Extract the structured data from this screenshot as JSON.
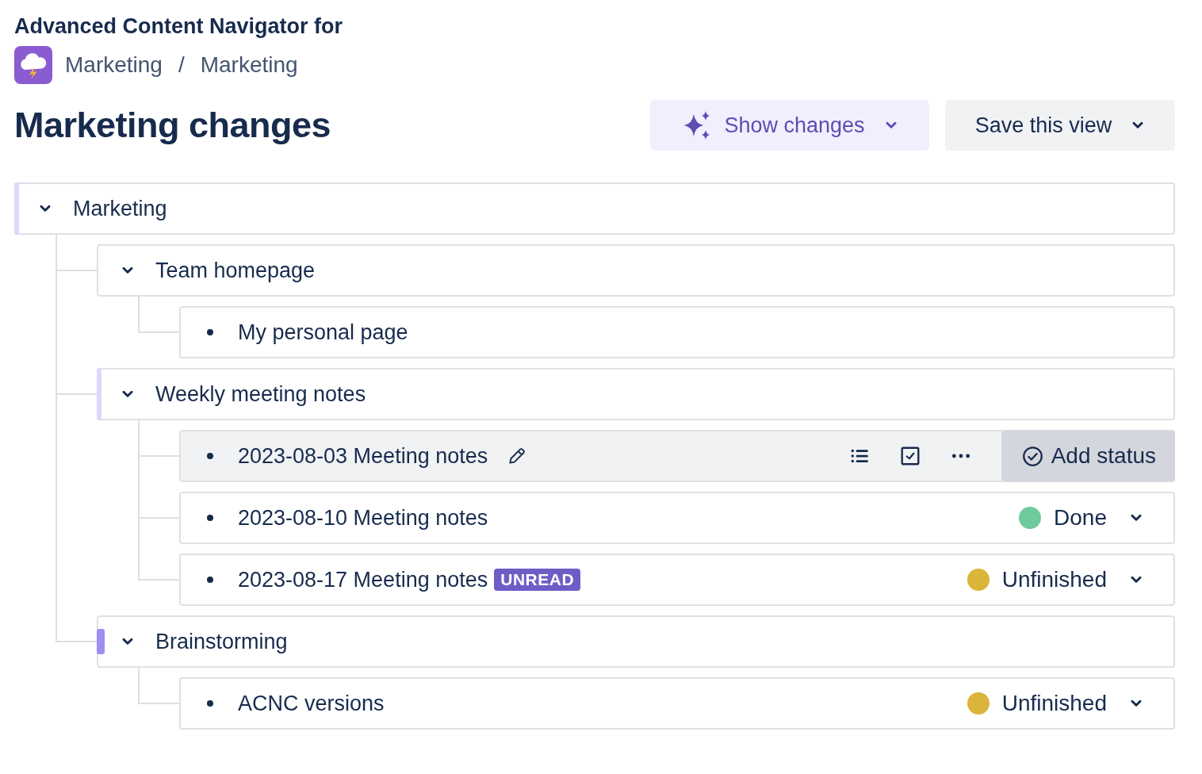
{
  "header": {
    "app_title": "Advanced Content Navigator for",
    "breadcrumbs": [
      "Marketing",
      "Marketing"
    ],
    "separator": "/"
  },
  "page_title": "Marketing changes",
  "actions": [
    {
      "label": "Show changes",
      "kind": "primary"
    },
    {
      "label": "Save this view",
      "kind": "default"
    }
  ],
  "tree": [
    {
      "title": "Marketing",
      "expanded": true,
      "accent": {
        "kind": "full",
        "color": "#dcd7fb"
      },
      "children": [
        {
          "title": "Team homepage",
          "expanded": true,
          "children": [
            {
              "title": "My personal page"
            }
          ]
        },
        {
          "title": "Weekly meeting notes",
          "expanded": true,
          "accent": {
            "kind": "full",
            "color": "#dcd7fb"
          },
          "children": [
            {
              "title": "2023-08-03 Meeting notes",
              "hovered": true,
              "add_status": "Add status"
            },
            {
              "title": "2023-08-10 Meeting notes",
              "status": {
                "label": "Done",
                "color": "#6fcb9b"
              }
            },
            {
              "title": "2023-08-17 Meeting notes",
              "badge": "UNREAD",
              "status": {
                "label": "Unfinished",
                "color": "#dbb43a"
              }
            }
          ]
        },
        {
          "title": "Brainstorming",
          "expanded": true,
          "accent": {
            "kind": "short",
            "color": "#9f8fef"
          },
          "children": [
            {
              "title": "ACNC versions",
              "status": {
                "label": "Unfinished",
                "color": "#dbb43a"
              }
            }
          ]
        }
      ]
    }
  ]
}
